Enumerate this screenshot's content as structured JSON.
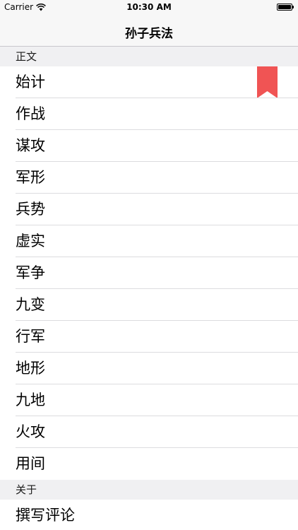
{
  "status_bar": {
    "carrier": "Carrier",
    "time": "10:30 AM",
    "battery_level": 1.0
  },
  "nav": {
    "title": "孙子兵法"
  },
  "sections": [
    {
      "header": "正文",
      "items": [
        "始计",
        "作战",
        "谋攻",
        "军形",
        "兵势",
        "虚实",
        "军争",
        "九变",
        "行军",
        "地形",
        "九地",
        "火攻",
        "用间"
      ]
    },
    {
      "header": "关于",
      "items": [
        "撰写评论"
      ]
    }
  ],
  "bookmark": {
    "icon": "bookmark-icon",
    "color": "#f05454"
  }
}
